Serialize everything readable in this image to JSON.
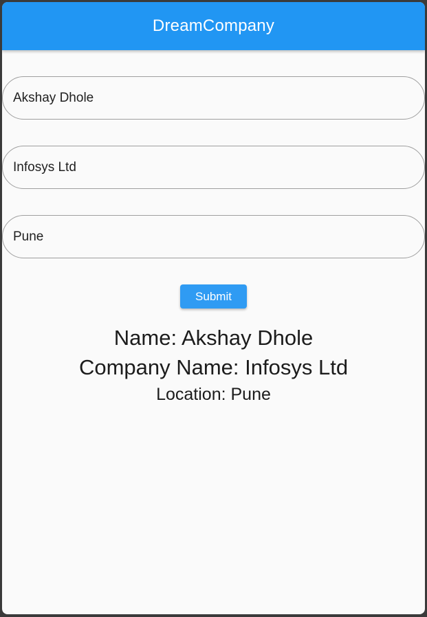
{
  "app_bar": {
    "title": "DreamCompany"
  },
  "form": {
    "name_value": "Akshay Dhole",
    "company_value": "Infosys Ltd",
    "location_value": "Pune",
    "submit_label": "Submit"
  },
  "result": {
    "name_line": "Name: Akshay Dhole",
    "company_line": "Company Name: Infosys Ltd",
    "location_line": "Location: Pune"
  },
  "colors": {
    "app_bar": "#2196f3",
    "button": "#2f9bf3",
    "background": "#fafafa",
    "frame": "#3a3a3a"
  }
}
